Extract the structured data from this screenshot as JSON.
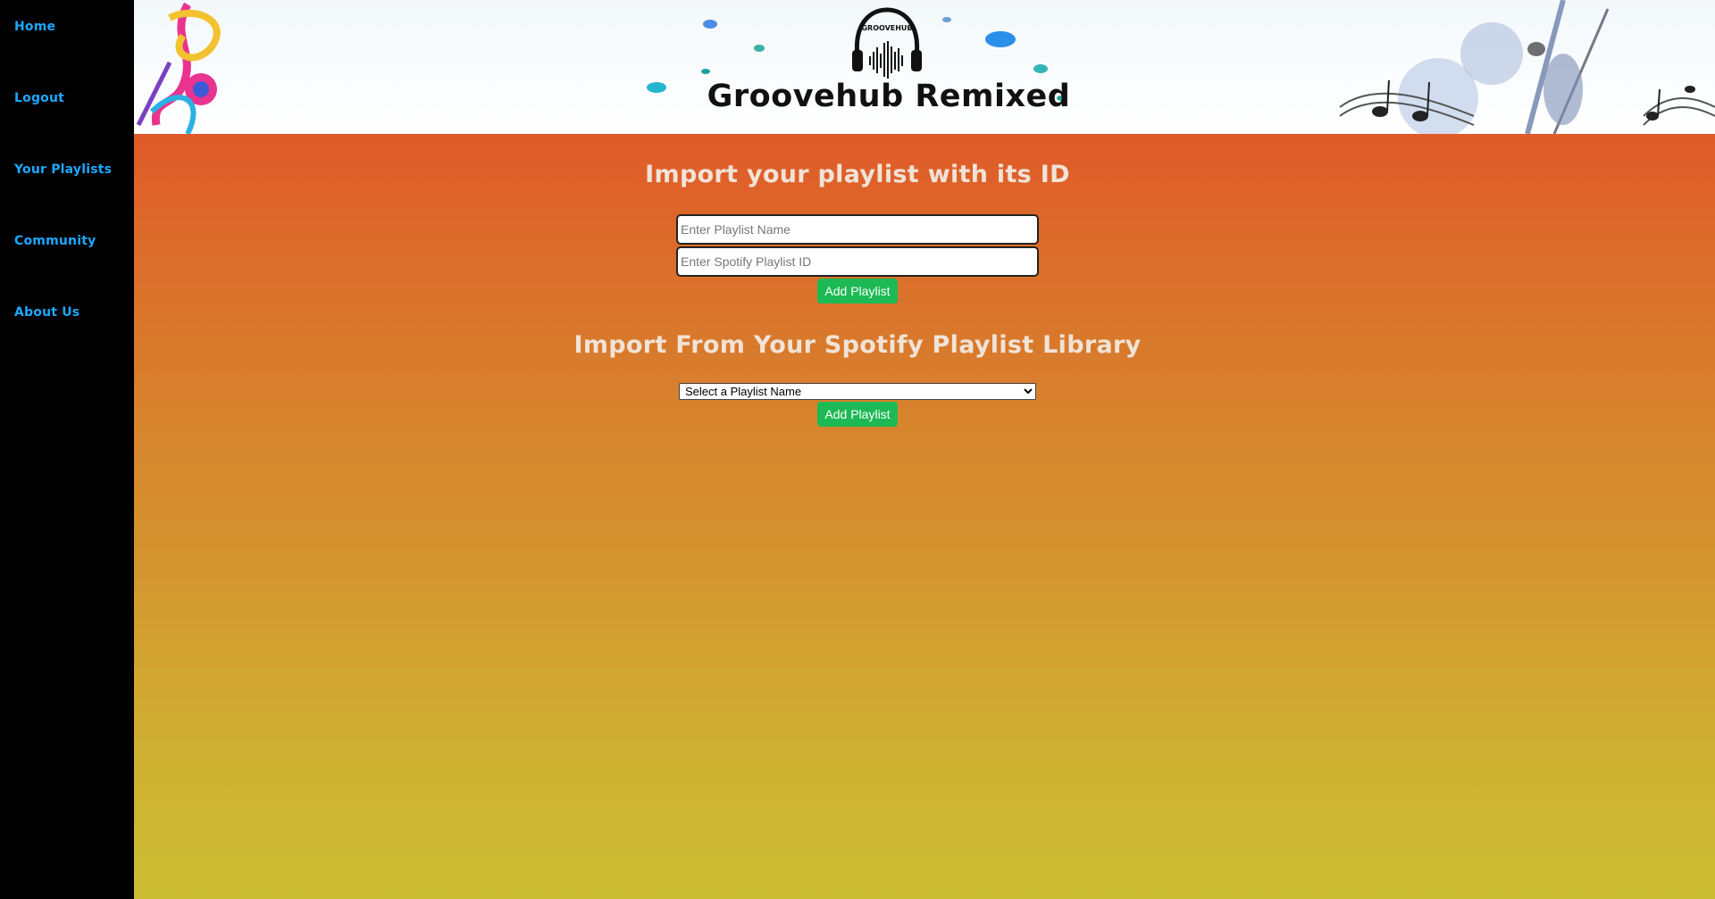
{
  "nav": {
    "items": [
      {
        "label": "Home"
      },
      {
        "label": "Logout"
      },
      {
        "label": "Your Playlists"
      },
      {
        "label": "Community"
      },
      {
        "label": "About Us"
      }
    ]
  },
  "header": {
    "logo_text": "GROOVEHUB",
    "title": "Groovehub Remixed"
  },
  "import_by_id": {
    "title": "Import your playlist with its ID",
    "name_placeholder": "Enter Playlist Name",
    "id_placeholder": "Enter Spotify Playlist ID",
    "button_label": "Add Playlist"
  },
  "import_library": {
    "title": "Import From Your Spotify Playlist Library",
    "select_value": "Select a Playlist Name",
    "button_label": "Add Playlist"
  },
  "colors": {
    "nav_link": "#1ea7ff",
    "button": "#1db954",
    "gradient_top": "#e05a2a",
    "gradient_bottom": "#cbbd33",
    "section_title": "#f1e3d6"
  }
}
